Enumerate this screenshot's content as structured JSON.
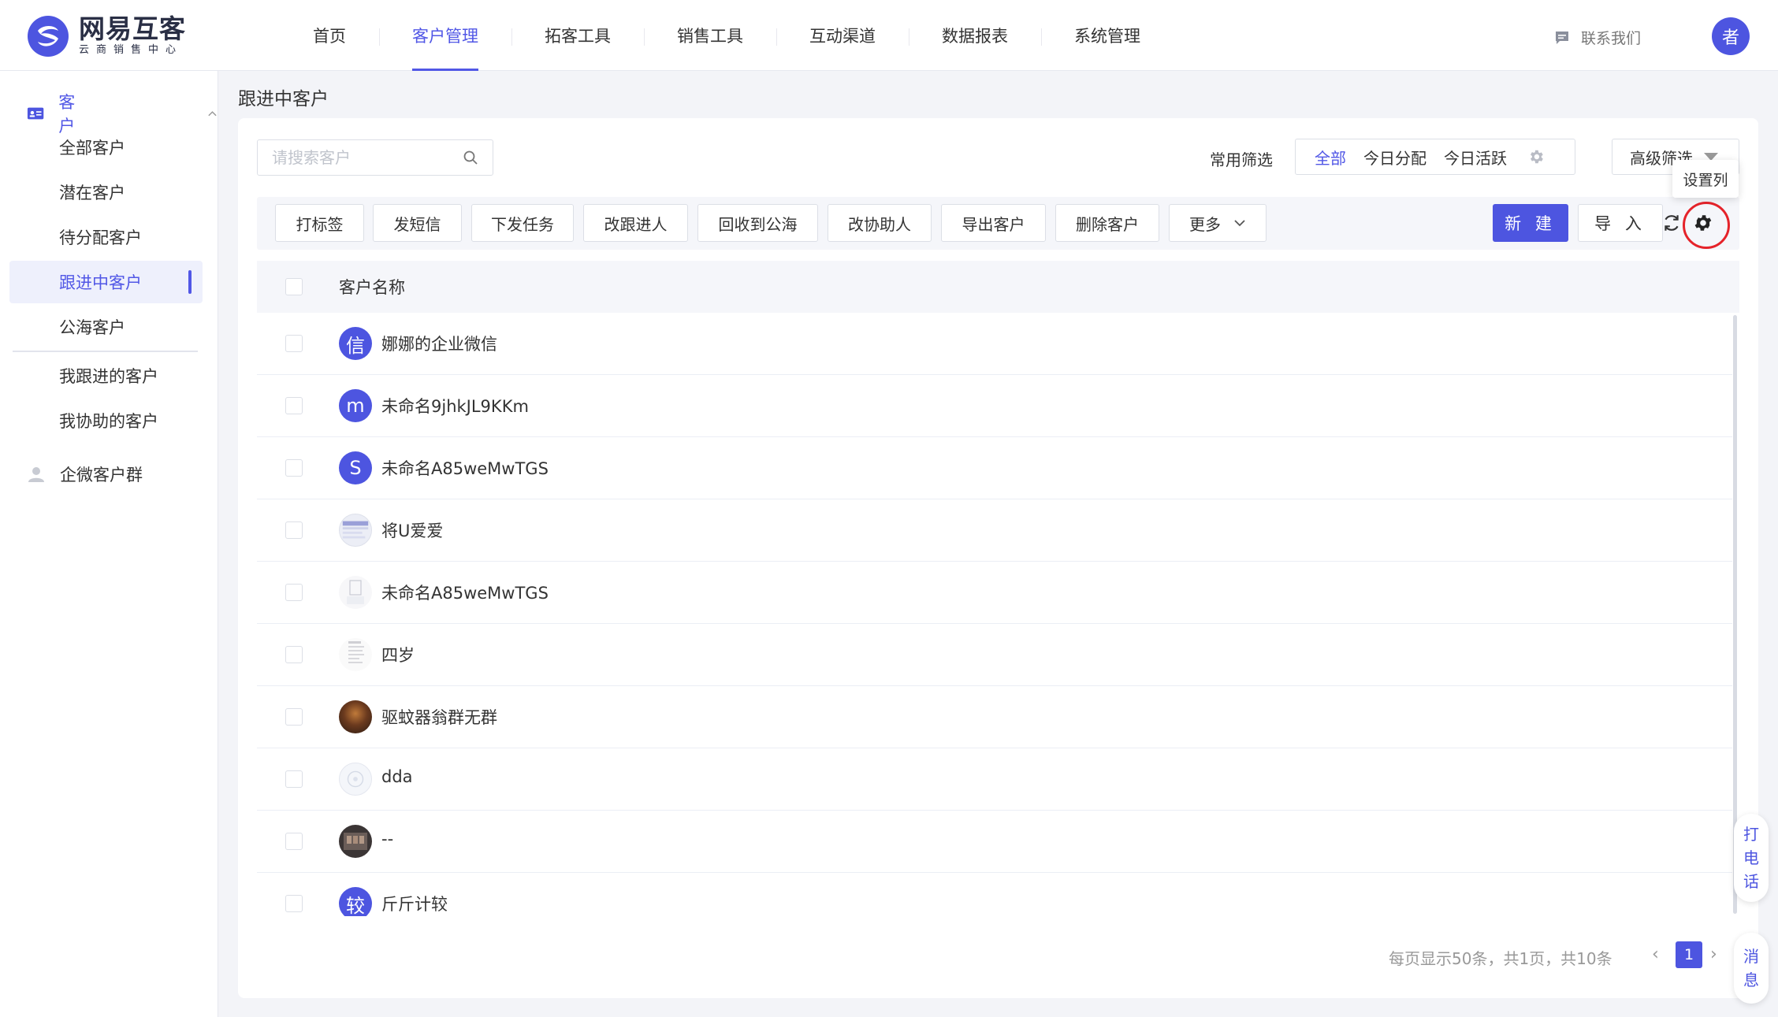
{
  "header": {
    "logo_name": "网易互客",
    "logo_sub": "云商销售中心",
    "nav": [
      "首页",
      "客户管理",
      "拓客工具",
      "销售工具",
      "互动渠道",
      "数据报表",
      "系统管理"
    ],
    "nav_active": "客户管理",
    "contact_label": "联系我们",
    "avatar_text": "者",
    "brand_color": "#4d55e0"
  },
  "sidebar": {
    "group_customer": "客户",
    "items": [
      "全部客户",
      "潜在客户",
      "待分配客户",
      "跟进中客户",
      "公海客户",
      "我跟进的客户",
      "我协助的客户"
    ],
    "active": "跟进中客户",
    "group_wecom": "企微客户群"
  },
  "page": {
    "title": "跟进中客户",
    "search_placeholder": "请搜索客户",
    "filter_label": "常用筛选",
    "filters": [
      "全部",
      "今日分配",
      "今日活跃"
    ],
    "filter_active": "全部",
    "advanced_filter": "高级筛选",
    "tooltip": "设置列"
  },
  "toolbar": {
    "actions": [
      "打标签",
      "发短信",
      "下发任务",
      "改跟进人",
      "回收到公海",
      "改协助人",
      "导出客户",
      "删除客户",
      "更多"
    ],
    "new_label": "新 建",
    "import_label": "导 入"
  },
  "table": {
    "column": "客户名称",
    "rows": [
      {
        "avatar": "信",
        "name": "娜娜的企业微信"
      },
      {
        "avatar": "m",
        "name": "未命名9jhkJL9KKm"
      },
      {
        "avatar": "S",
        "name": "未命名A85weMwTGS"
      },
      {
        "avatar": "",
        "name": "将U爱爱"
      },
      {
        "avatar": "",
        "name": "未命名A85weMwTGS"
      },
      {
        "avatar": "",
        "name": "四岁"
      },
      {
        "avatar": "",
        "name": "驱蚊器翁群无群"
      },
      {
        "avatar": "",
        "name": "dda"
      },
      {
        "avatar": "",
        "name": "--"
      },
      {
        "avatar": "较",
        "name": "斤斤计较"
      }
    ]
  },
  "pagination": {
    "info": "每页显示50条，共1页，共10条",
    "current_page": "1"
  },
  "floating": {
    "call": [
      "打",
      "电",
      "话"
    ],
    "message": [
      "消",
      "息"
    ]
  }
}
